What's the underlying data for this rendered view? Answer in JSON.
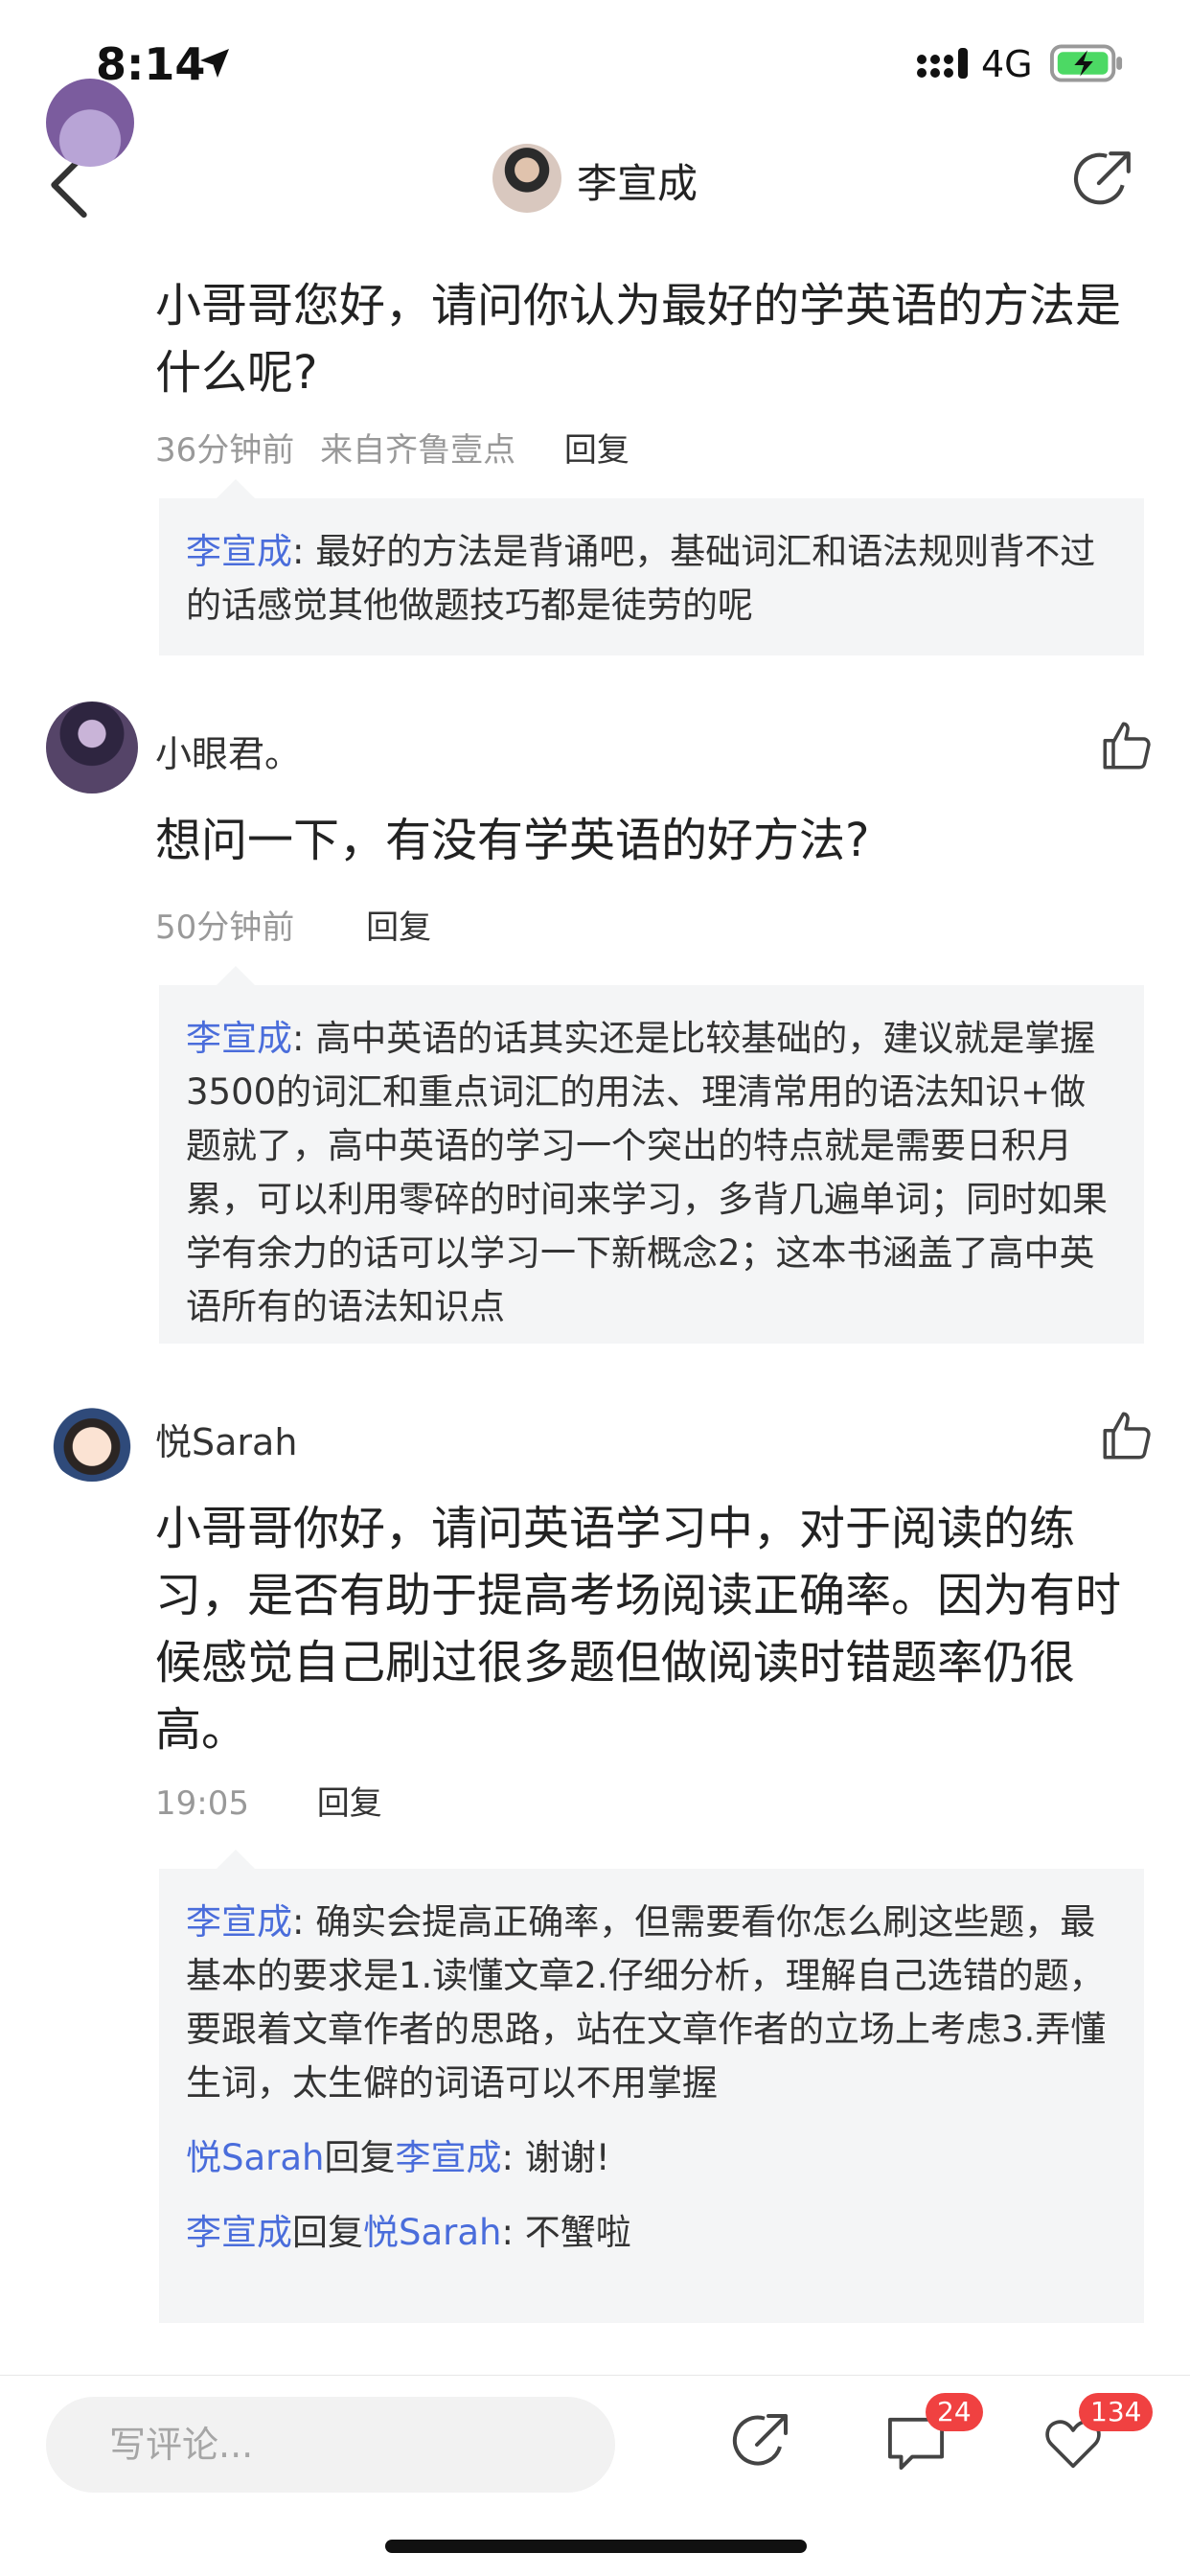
{
  "status": {
    "time": "8:14",
    "network": "4G"
  },
  "header": {
    "title": "李宣成"
  },
  "comments": [
    {
      "body": "小哥哥您好，请问你认为最好的学英语的方法是什么呢?",
      "time": "36分钟前",
      "source": "来自齐鲁壹点",
      "reply_label": "回复",
      "replies": [
        {
          "author": "李宣成",
          "text": ": 最好的方法是背诵吧，基础词汇和语法规则背不过的话感觉其他做题技巧都是徒劳的呢"
        }
      ]
    },
    {
      "author": "小眼君。",
      "body": "想问一下，有没有学英语的好方法?",
      "time": "50分钟前",
      "reply_label": "回复",
      "replies": [
        {
          "author": "李宣成",
          "text": ": 高中英语的话其实还是比较基础的，建议就是掌握3500的词汇和重点词汇的用法、理清常用的语法知识+做题就了，高中英语的学习一个突出的特点就是需要日积月累，可以利用零碎的时间来学习，多背几遍单词；同时如果学有余力的话可以学习一下新概念2；这本书涵盖了高中英语所有的语法知识点"
        }
      ]
    },
    {
      "author": "悦Sarah",
      "body": "小哥哥你好，请问英语学习中，对于阅读的练习，是否有助于提高考场阅读正确率。因为有时候感觉自己刷过很多题但做阅读时错题率仍很高。",
      "time": "19:05",
      "reply_label": "回复",
      "replies": [
        {
          "author": "李宣成",
          "text": ": 确实会提高正确率，但需要看你怎么刷这些题，最基本的要求是1.读懂文章2.仔细分析，理解自己选错的题，要跟着文章作者的思路，站在文章作者的立场上考虑3.弄懂生词，太生僻的词语可以不用掌握"
        },
        {
          "author": "悦Sarah",
          "mid": "回复",
          "target": "李宣成",
          "text": ": 谢谢!"
        },
        {
          "author": "李宣成",
          "mid": "回复",
          "target": "悦Sarah",
          "text": ": 不蟹啦"
        }
      ]
    }
  ],
  "bottom": {
    "placeholder": "写评论...",
    "comment_count": "24",
    "like_count": "134"
  },
  "colors": {
    "link": "#4a6ddb",
    "badge": "#f04141",
    "reply_bg": "#f4f5f6"
  }
}
